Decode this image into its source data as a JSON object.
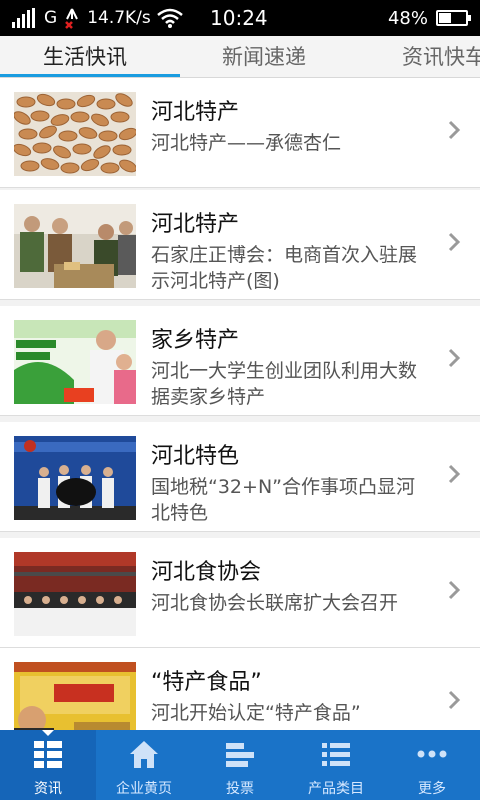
{
  "status_bar": {
    "network": "G",
    "speed": "14.7K/s",
    "time": "10:24",
    "battery": "48%",
    "battery_level": 0.48
  },
  "tabs": [
    {
      "label": "生活快讯",
      "active": true
    },
    {
      "label": "新闻速递",
      "active": false
    },
    {
      "label": "资讯快车",
      "active": false
    }
  ],
  "news": [
    {
      "title": "河北特产",
      "desc": "河北特产——承德杏仁"
    },
    {
      "title": "河北特产",
      "desc": "石家庄正博会：电商首次入驻展示河北特产(图)"
    },
    {
      "title": "家乡特产",
      "desc": "河北一大学生创业团队利用大数据卖家乡特产"
    },
    {
      "title": "河北特色",
      "desc": "国地税“32+N”合作事项凸显河北特色"
    },
    {
      "title": "河北食协会",
      "desc": "河北食协会长联席扩大会召开"
    },
    {
      "title": "“特产食品”",
      "desc": "河北开始认定“特产食品”"
    }
  ],
  "bottom_nav": [
    {
      "label": "资讯",
      "icon": "news-grid-icon",
      "active": true
    },
    {
      "label": "企业黄页",
      "icon": "home-icon",
      "active": false
    },
    {
      "label": "投票",
      "icon": "bar-chart-icon",
      "active": false
    },
    {
      "label": "产品类目",
      "icon": "list-icon",
      "active": false
    },
    {
      "label": "更多",
      "icon": "more-dots-icon",
      "active": false
    }
  ],
  "colors": {
    "accent": "#1a9ce0",
    "nav_bg": "#1a73c8"
  }
}
